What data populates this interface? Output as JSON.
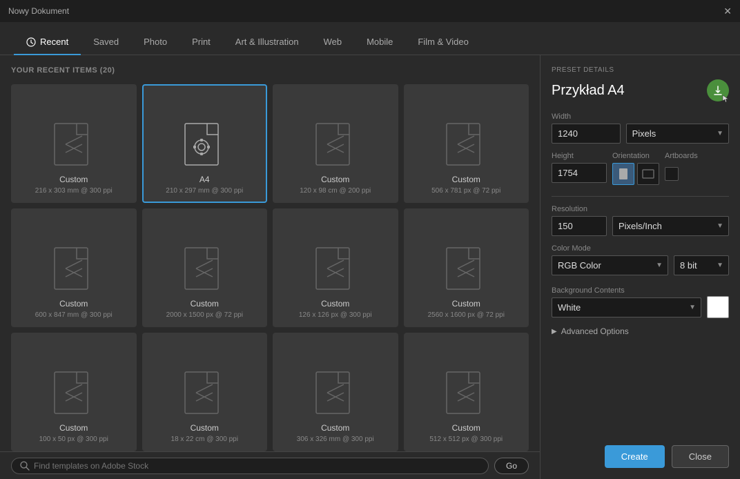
{
  "titlebar": {
    "title": "Nowy Dokument",
    "close_label": "✕"
  },
  "tabs": [
    {
      "id": "recent",
      "label": "Recent",
      "active": true,
      "has_clock": true
    },
    {
      "id": "saved",
      "label": "Saved",
      "active": false
    },
    {
      "id": "photo",
      "label": "Photo",
      "active": false
    },
    {
      "id": "print",
      "label": "Print",
      "active": false
    },
    {
      "id": "art",
      "label": "Art & Illustration",
      "active": false
    },
    {
      "id": "web",
      "label": "Web",
      "active": false
    },
    {
      "id": "mobile",
      "label": "Mobile",
      "active": false
    },
    {
      "id": "film",
      "label": "Film & Video",
      "active": false
    }
  ],
  "recent_header": "YOUR RECENT ITEMS",
  "recent_count": "(20)",
  "grid_items": [
    {
      "id": 1,
      "name": "Custom",
      "size": "216 x 303 mm @ 300 ppi",
      "selected": false
    },
    {
      "id": 2,
      "name": "A4",
      "size": "210 x 297 mm @ 300 ppi",
      "selected": true
    },
    {
      "id": 3,
      "name": "Custom",
      "size": "120 x 98 cm @ 200 ppi",
      "selected": false
    },
    {
      "id": 4,
      "name": "Custom",
      "size": "506 x 781 px @ 72 ppi",
      "selected": false
    },
    {
      "id": 5,
      "name": "Custom",
      "size": "600 x 847 mm @ 300 ppi",
      "selected": false
    },
    {
      "id": 6,
      "name": "Custom",
      "size": "2000 x 1500 px @ 72 ppi",
      "selected": false
    },
    {
      "id": 7,
      "name": "Custom",
      "size": "126 x 126 px @ 300 ppi",
      "selected": false
    },
    {
      "id": 8,
      "name": "Custom",
      "size": "2560 x 1600 px @ 72 ppi",
      "selected": false
    },
    {
      "id": 9,
      "name": "Custom",
      "size": "100 x 50 px @ 300 ppi",
      "selected": false
    },
    {
      "id": 10,
      "name": "Custom",
      "size": "18 x 22 cm @ 300 ppi",
      "selected": false
    },
    {
      "id": 11,
      "name": "Custom",
      "size": "306 x 326 mm @ 300 ppi",
      "selected": false
    },
    {
      "id": 12,
      "name": "Custom",
      "size": "512 x 512 px @ 300 ppi",
      "selected": false
    }
  ],
  "search": {
    "placeholder": "Find templates on Adobe Stock",
    "go_label": "Go"
  },
  "preset_details": {
    "label": "PRESET DETAILS",
    "title": "Przykład A4",
    "width_label": "Width",
    "width_value": "1240",
    "width_unit": "Pixels",
    "height_label": "Height",
    "height_value": "1754",
    "orientation_label": "Orientation",
    "artboards_label": "Artboards",
    "resolution_label": "Resolution",
    "resolution_value": "150",
    "resolution_unit": "Pixels/Inch",
    "color_mode_label": "Color Mode",
    "color_mode_value": "RGB Color",
    "bit_depth_value": "8 bit",
    "bg_contents_label": "Background Contents",
    "bg_contents_value": "White",
    "advanced_label": "Advanced Options"
  },
  "buttons": {
    "create": "Create",
    "close": "Close"
  },
  "colors": {
    "accent_blue": "#3a9ad9",
    "accent_green": "#4a8f3c"
  }
}
